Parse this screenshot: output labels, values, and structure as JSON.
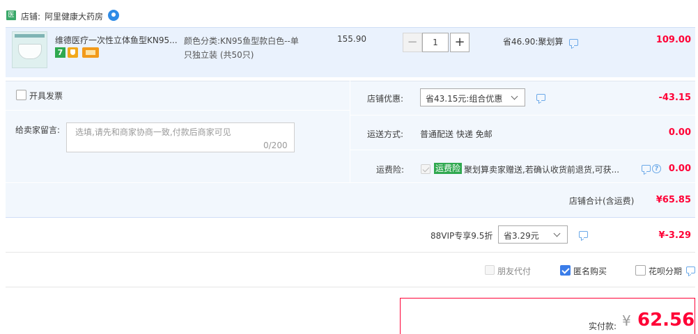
{
  "shop": {
    "badge": "医",
    "label": "店铺:",
    "name": "阿里健康大药房"
  },
  "item": {
    "title": "维德医疗一次性立体鱼型KN95...",
    "sku_line1": "颜色分类:KN95鱼型款白色--单",
    "sku_line2": "只独立装 (共50只)",
    "price": "155.90",
    "quantity": "1",
    "qty_minus": "−",
    "qty_plus": "+",
    "saving": "省46.90:聚划算",
    "total": "109.00",
    "tags": [
      "7",
      "shield-icon",
      "card-icon"
    ]
  },
  "invoice": {
    "label": "开具发票",
    "checked": false
  },
  "message": {
    "label": "给卖家留言:",
    "placeholder": "选填,请先和商家协商一致,付款后商家可见",
    "count": "0/200"
  },
  "store_discount": {
    "label": "店铺优惠:",
    "selected": "省43.15元:组合优惠",
    "value": "-43.15"
  },
  "shipping": {
    "label": "运送方式:",
    "text": "普通配送 快递 免邮",
    "value": "0.00"
  },
  "insurance": {
    "label": "运费险:",
    "badge": "运费险",
    "desc": "聚划算卖家赠送,若确认收货前退货,可获...",
    "value": "0.00",
    "help": "?"
  },
  "store_total": {
    "label": "店铺合计(含运费)",
    "value": "¥65.85"
  },
  "vip": {
    "label": "88VIP专享9.5折",
    "selected": "省3.29元",
    "value": "¥-3.29"
  },
  "pay_options": [
    {
      "label": "朋友代付",
      "state": "disabled"
    },
    {
      "label": "匿名购买",
      "state": "checked"
    },
    {
      "label": "花呗分期",
      "state": "unchecked"
    }
  ],
  "final": {
    "label": "实付款:",
    "yen": "¥",
    "amount": "62.56"
  },
  "colors": {
    "accent_red": "#ff0036",
    "row_bg": "#eaf2fd",
    "option_bg": "#f2f7fd",
    "link_blue": "#6aa8e8",
    "insurance_green": "#2fa84f"
  }
}
